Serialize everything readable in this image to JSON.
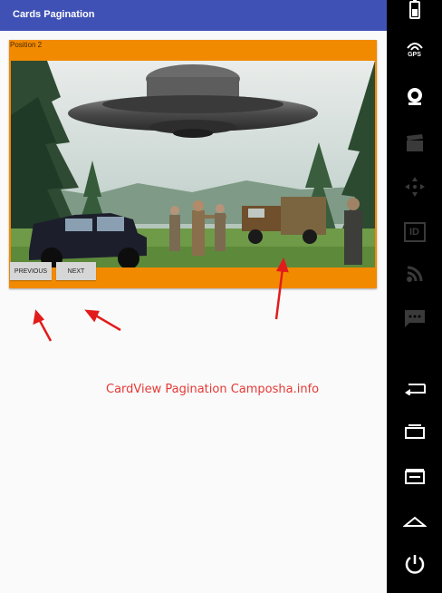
{
  "app": {
    "title": "Cards Pagination"
  },
  "card": {
    "position_label": "Position 2",
    "image_icon": "ufo-cars-soldiers-painting"
  },
  "buttons": {
    "previous": "PREVIOUS",
    "next": "NEXT"
  },
  "watermark": "CardView Pagination Camposha.info",
  "navbar": {
    "icons": [
      "battery-icon",
      "gps-icon",
      "camera-icon",
      "clapper-icon",
      "dpad-icon",
      "id-icon",
      "rss-icon",
      "message-icon",
      "back-icon",
      "recent-apps-icon",
      "menu-icon",
      "home-icon",
      "power-icon"
    ],
    "gps_label": "GPS",
    "id_label": "ID"
  },
  "colors": {
    "appbar": "#3f51b5",
    "card": "#f28a00",
    "button": "#d6d6d6",
    "watermark": "#e53935",
    "annotation_arrow": "#e21b1b"
  }
}
